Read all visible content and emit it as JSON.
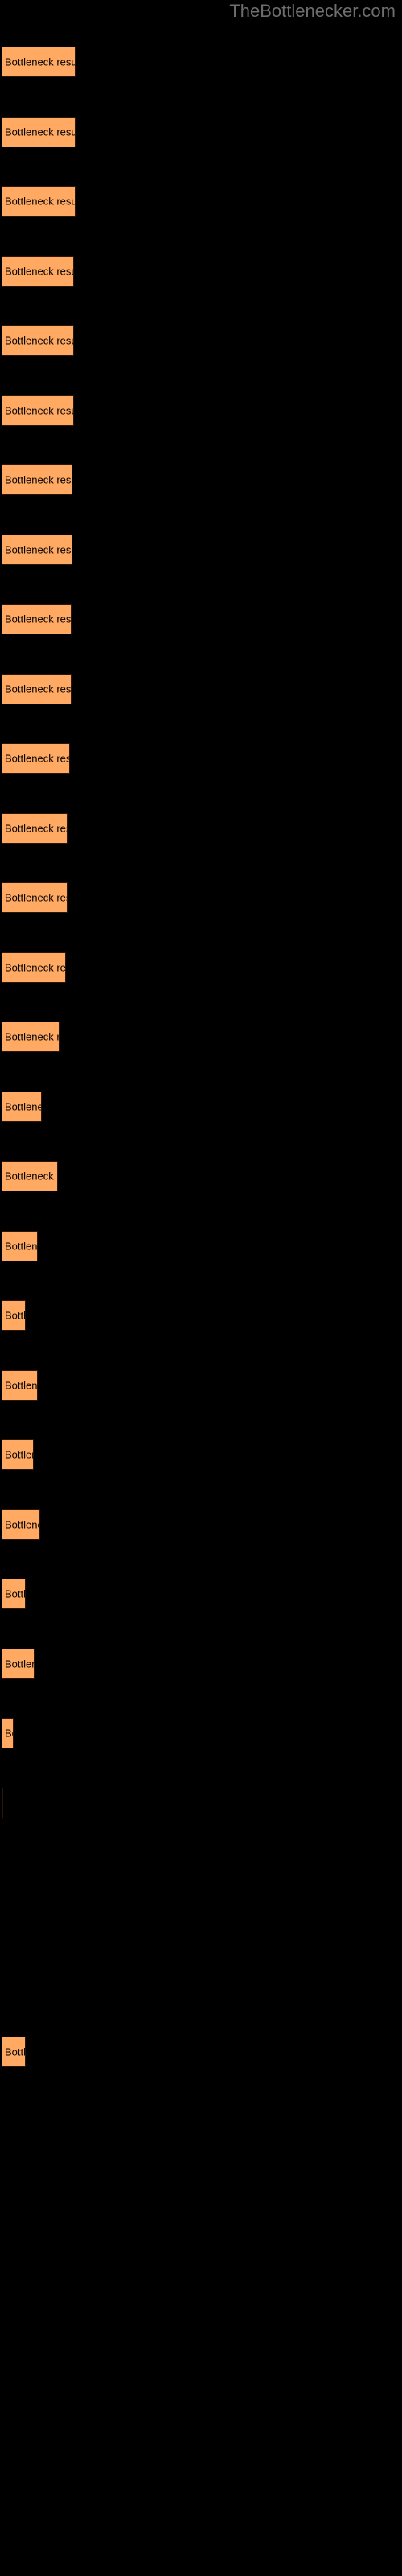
{
  "watermark": {
    "text": "TheBottlenecker.com"
  },
  "colors": {
    "background": "#000000",
    "bar_fill": "#ffa963",
    "bar_border": "#2b1408",
    "bar_label": "#000000",
    "watermark": "#6e6e6e"
  },
  "chart_data": {
    "type": "bar",
    "orientation": "horizontal",
    "title": "",
    "subtitle": "",
    "xlabel": "",
    "ylabel": "",
    "grid": false,
    "legend": null,
    "axis_visible": false,
    "tick_labels_visible": false,
    "bar_label_text": "Bottleneck result",
    "xlim": [
      0,
      500
    ],
    "categories": [
      "Bottleneck result",
      "Bottleneck result",
      "Bottleneck result",
      "Bottleneck result",
      "Bottleneck result",
      "Bottleneck result",
      "Bottleneck result",
      "Bottleneck result",
      "Bottleneck result",
      "Bottleneck result",
      "Bottleneck result",
      "Bottleneck result",
      "Bottleneck result",
      "Bottleneck result",
      "Bottleneck result",
      "Bottleneck result",
      "Bottleneck result",
      "Bottleneck result",
      "Bottleneck result",
      "Bottleneck result",
      "Bottleneck result",
      "Bottleneck result",
      "Bottleneck result",
      "Bottleneck result",
      "Bottleneck result",
      "Bottleneck result",
      "Bottleneck result",
      "Bottleneck result",
      "Bottleneck result",
      "Bottleneck result"
    ],
    "values": [
      92,
      92,
      92,
      90,
      90,
      90,
      88,
      88,
      88,
      87,
      85,
      82,
      82,
      80,
      73,
      50,
      70,
      45,
      30,
      45,
      40,
      48,
      30,
      41,
      15,
      2,
      0,
      0,
      0,
      30
    ],
    "bars": [
      {
        "index": 0,
        "y": 58,
        "width": 92,
        "height": 38,
        "label": "Bottleneck result"
      },
      {
        "index": 1,
        "y": 145,
        "width": 92,
        "height": 38,
        "label": "Bottleneck result"
      },
      {
        "index": 2,
        "y": 231,
        "width": 92,
        "height": 38,
        "label": "Bottleneck result"
      },
      {
        "index": 3,
        "y": 318,
        "width": 90,
        "height": 38,
        "label": "Bottleneck result"
      },
      {
        "index": 4,
        "y": 404,
        "width": 90,
        "height": 38,
        "label": "Bottleneck result"
      },
      {
        "index": 5,
        "y": 491,
        "width": 90,
        "height": 38,
        "label": "Bottleneck result"
      },
      {
        "index": 6,
        "y": 577,
        "width": 88,
        "height": 38,
        "label": "Bottleneck result"
      },
      {
        "index": 7,
        "y": 664,
        "width": 88,
        "height": 38,
        "label": "Bottleneck result"
      },
      {
        "index": 8,
        "y": 750,
        "width": 87,
        "height": 38,
        "label": "Bottleneck result"
      },
      {
        "index": 9,
        "y": 837,
        "width": 87,
        "height": 38,
        "label": "Bottleneck result"
      },
      {
        "index": 10,
        "y": 923,
        "width": 85,
        "height": 38,
        "label": "Bottleneck result"
      },
      {
        "index": 11,
        "y": 1010,
        "width": 82,
        "height": 38,
        "label": "Bottleneck result"
      },
      {
        "index": 12,
        "y": 1096,
        "width": 82,
        "height": 38,
        "label": "Bottleneck result"
      },
      {
        "index": 13,
        "y": 1183,
        "width": 80,
        "height": 38,
        "label": "Bottleneck result"
      },
      {
        "index": 14,
        "y": 1269,
        "width": 73,
        "height": 38,
        "label": "Bottleneck result"
      },
      {
        "index": 15,
        "y": 1356,
        "width": 50,
        "height": 38,
        "label": "Bottleneck result"
      },
      {
        "index": 16,
        "y": 1442,
        "width": 70,
        "height": 38,
        "label": "Bottleneck result"
      },
      {
        "index": 17,
        "y": 1529,
        "width": 45,
        "height": 38,
        "label": "Bottleneck result"
      },
      {
        "index": 18,
        "y": 1615,
        "width": 30,
        "height": 38,
        "label": "Bottleneck result"
      },
      {
        "index": 19,
        "y": 1702,
        "width": 45,
        "height": 38,
        "label": "Bottleneck result"
      },
      {
        "index": 20,
        "y": 1788,
        "width": 40,
        "height": 38,
        "label": "Bottleneck result"
      },
      {
        "index": 21,
        "y": 1875,
        "width": 48,
        "height": 38,
        "label": "Bottleneck result"
      },
      {
        "index": 22,
        "y": 1961,
        "width": 30,
        "height": 38,
        "label": "Bottleneck result"
      },
      {
        "index": 23,
        "y": 2048,
        "width": 41,
        "height": 38,
        "label": "Bottleneck result"
      },
      {
        "index": 24,
        "y": 2134,
        "width": 15,
        "height": 38,
        "label": "Bottleneck result"
      },
      {
        "index": 25,
        "y": 2221,
        "width": 2,
        "height": 38,
        "label": "Bottleneck result"
      },
      {
        "index": 26,
        "y": 2307,
        "width": 0,
        "height": 38,
        "label": "Bottleneck result"
      },
      {
        "index": 27,
        "y": 2394,
        "width": 0,
        "height": 38,
        "label": "Bottleneck result"
      },
      {
        "index": 28,
        "y": 2480,
        "width": 0,
        "height": 38,
        "label": "Bottleneck result"
      },
      {
        "index": 29,
        "y": 2530,
        "width": 30,
        "height": 38,
        "label": "Bottleneck result"
      }
    ]
  }
}
